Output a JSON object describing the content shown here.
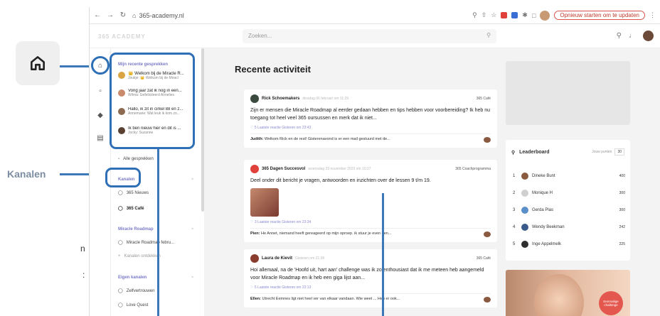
{
  "annotations": {
    "kanalen_label": "Kanalen",
    "left_fragment_1": "n",
    "left_fragment_2": ":"
  },
  "browser": {
    "url": "365-academy.nl",
    "update_button": "Opnieuw starten om te updaten"
  },
  "app": {
    "logo": "365 ACADEMY",
    "search_placeholder": "Zoeken..."
  },
  "sidebar": {
    "recent_title": "Mijn recente gesprekken",
    "conversations": [
      {
        "title": "👑 Welkom bij de Miracle R...",
        "sub": "Joukje: 👑 Welkom bij de Miracl",
        "color": "#d9a441"
      },
      {
        "title": "Vorig jaar zat ik nog in een...",
        "sub": "Wilma: Gefeliciteerd Annelies",
        "color": "#c98b6b"
      },
      {
        "title": "Hallo, ik zit in cirkel 88 en z...",
        "sub": "Annemarie: Wat leuk ik kom zo...",
        "color": "#8c6a52"
      },
      {
        "title": "Ik ben nieuw hier en dit is ...",
        "sub": "Jocky: Suzanne",
        "color": "#5a4030"
      }
    ],
    "all_conversations": "Alle gesprekken",
    "channels_title": "Kanalen",
    "channels": [
      {
        "label": "365 Nieuws",
        "bold": false
      },
      {
        "label": "365 Café",
        "bold": true
      }
    ],
    "roadmap_title": "Miracle Roadmap",
    "roadmap_items": [
      "Miracle Roadmap febru...",
      "Kanalen ontdekken"
    ],
    "own_title": "Eigen kanalen",
    "own_items": [
      "Zelfvertrouwen",
      "Love Quest"
    ]
  },
  "feed": {
    "title": "Recente activiteit",
    "posts": [
      {
        "author": "Rick Schoemakers",
        "date": "dinsdag 06 februari om 11:29",
        "tag": "365 Café",
        "body": "Zijn er mensen die Miracle Roadmap al eerder gedaan hebben en tips hebben voor voorbereiding? Ik heb nu toegang tot heel veel 365 oursussen en merk dat ik niet...",
        "meta": "♡ 5   Laatste reactie   Gisteren om 23:43",
        "reply_author": "Judith:",
        "reply": "Welkom Rick en de rest! Gisterenavond is er een mail gestuurd met de...",
        "avatar_color": "#3a4a3c",
        "photo": false
      },
      {
        "author": "365 Dagen Succesvol",
        "date": "woensdag 29 november 2023 om 10:37",
        "tag": "365 Coachprogramma",
        "body": "Deel onder dit bericht je vragen, antwoorden en inzichten over de lessen 9 t/m 19.",
        "meta": "♡ 3   Laatste reactie   Gisteren om 23:34",
        "reply_author": "Pien:",
        "reply": "He Annet, niemand heeft gereageerd op mijn oproep. ik stuur je even een...",
        "avatar_color": "#e0413a",
        "photo": true
      },
      {
        "author": "Laura de Kievit",
        "date": "Gisteren om 21:39",
        "tag": "365 Café",
        "body": "Hoi allemaal, na de 'Hoofd uit, hart aan' challenge was ik zo enthousiast dat ik me meteen heb aangemeld voor Miracle Roadmap en ik heb een giga lijst aan...",
        "meta": "♡ 5   Laatste reactie   Gisteren om 22:13",
        "reply_author": "Ellen:",
        "reply": "Utrecht Eemnes ligt niet heel ver van elkaar vandaan. Wie weet ... Heb er ook...",
        "avatar_color": "#8a3d2e",
        "photo": false
      }
    ]
  },
  "leaderboard": {
    "title": "Leaderboard",
    "points_label": "Jouw punten",
    "points_value": "30",
    "rows": [
      {
        "rank": "1",
        "name": "Dineke Bunt",
        "score": "400",
        "color": "#8a5a40"
      },
      {
        "rank": "2",
        "name": "Monique H",
        "score": "300",
        "color": "#cfcfcf"
      },
      {
        "rank": "3",
        "name": "Gerda Plas",
        "score": "300",
        "color": "#5b8fc9"
      },
      {
        "rank": "4",
        "name": "Wendy Beekman",
        "score": "242",
        "color": "#3a5a8c"
      },
      {
        "rank": "5",
        "name": "Inge Appelmelk",
        "score": "225",
        "color": "#2e2e2e"
      }
    ]
  },
  "promo": {
    "badge": "Eenmalige challenge"
  }
}
